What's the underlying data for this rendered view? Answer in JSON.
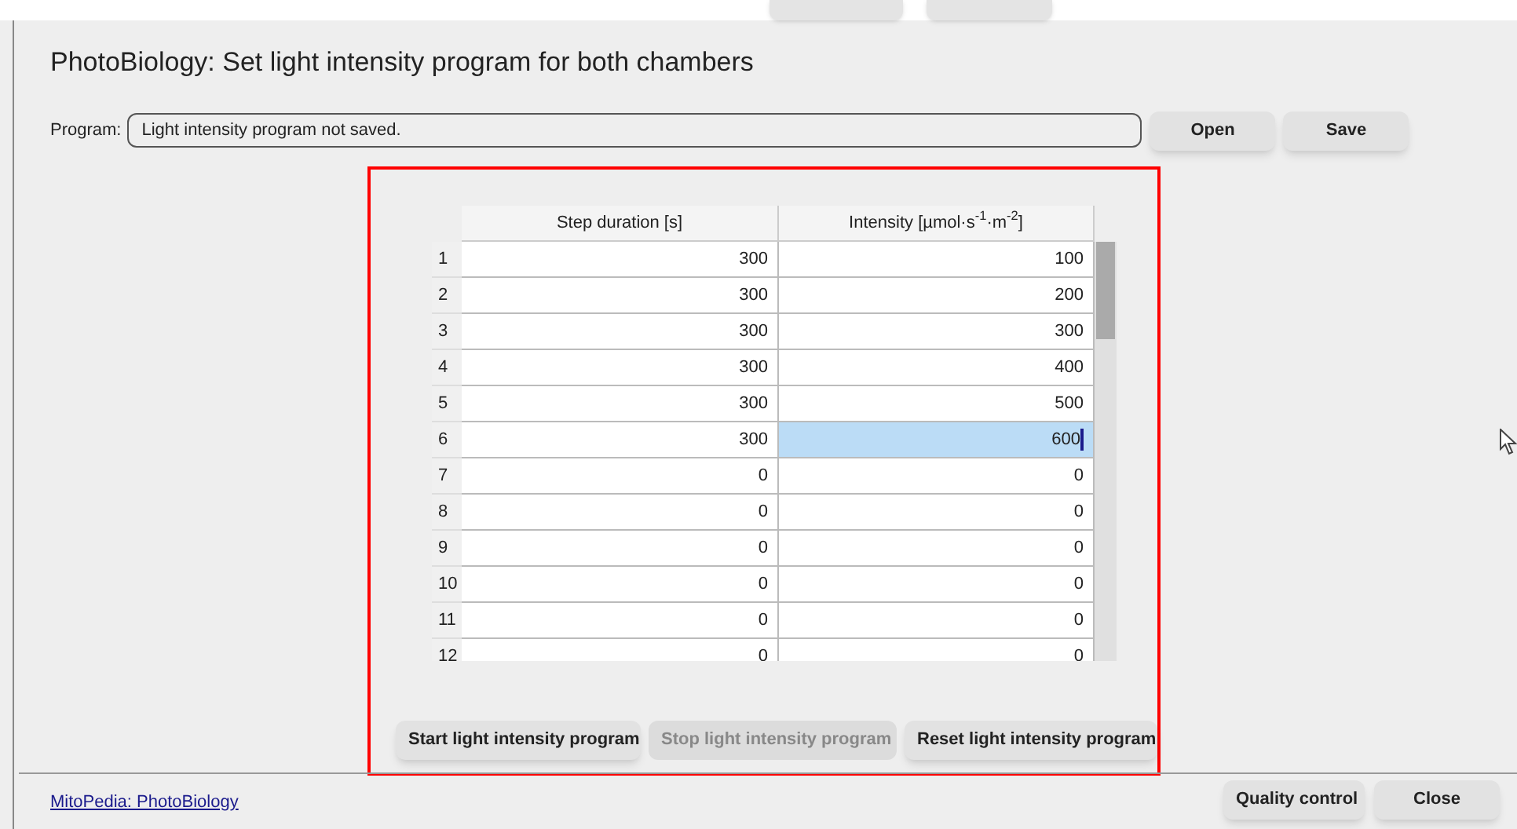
{
  "dialog": {
    "title": "PhotoBiology: Set light intensity program for both chambers"
  },
  "program": {
    "label": "Program:",
    "value": "Light intensity program not saved.",
    "buttons": [
      {
        "label": "Open"
      },
      {
        "label": "Save"
      }
    ]
  },
  "table_panel": {
    "highlighted": true,
    "columns": [
      "Step duration [s]",
      "Intensity [µmol·s$^{-1}$·m$^{-2}$]"
    ],
    "rows": [
      {
        "index": "1",
        "cells": [
          {
            "value": "300",
            "selected": false
          },
          {
            "value": "100",
            "selected": false
          }
        ]
      },
      {
        "index": "2",
        "cells": [
          {
            "value": "300",
            "selected": false
          },
          {
            "value": "200",
            "selected": false
          }
        ]
      },
      {
        "index": "3",
        "cells": [
          {
            "value": "300",
            "selected": false
          },
          {
            "value": "300",
            "selected": false
          }
        ]
      },
      {
        "index": "4",
        "cells": [
          {
            "value": "300",
            "selected": false
          },
          {
            "value": "400",
            "selected": false
          }
        ]
      },
      {
        "index": "5",
        "cells": [
          {
            "value": "300",
            "selected": false
          },
          {
            "value": "500",
            "selected": false
          }
        ]
      },
      {
        "index": "6",
        "cells": [
          {
            "value": "300",
            "selected": false
          },
          {
            "value": "600",
            "selected": true
          }
        ]
      },
      {
        "index": "7",
        "cells": [
          {
            "value": "0",
            "selected": false
          },
          {
            "value": "0",
            "selected": false
          }
        ]
      },
      {
        "index": "8",
        "cells": [
          {
            "value": "0",
            "selected": false
          },
          {
            "value": "0",
            "selected": false
          }
        ]
      },
      {
        "index": "9",
        "cells": [
          {
            "value": "0",
            "selected": false
          },
          {
            "value": "0",
            "selected": false
          }
        ]
      },
      {
        "index": "10",
        "cells": [
          {
            "value": "0",
            "selected": false
          },
          {
            "value": "0",
            "selected": false
          }
        ]
      },
      {
        "index": "11",
        "cells": [
          {
            "value": "0",
            "selected": false
          },
          {
            "value": "0",
            "selected": false
          }
        ]
      },
      {
        "index": "12",
        "cells": [
          {
            "value": "0",
            "selected": false
          },
          {
            "value": "0",
            "selected": false
          }
        ]
      }
    ],
    "buttons": [
      {
        "label": "Start light intensity program",
        "disabled": false
      },
      {
        "label": "Stop light intensity program",
        "disabled": true
      },
      {
        "label": "Reset light intensity program",
        "disabled": false
      }
    ]
  },
  "footer": {
    "link": "MitoPedia: PhotoBiology",
    "buttons": [
      {
        "label": "Quality control"
      },
      {
        "label": "Close"
      }
    ]
  }
}
